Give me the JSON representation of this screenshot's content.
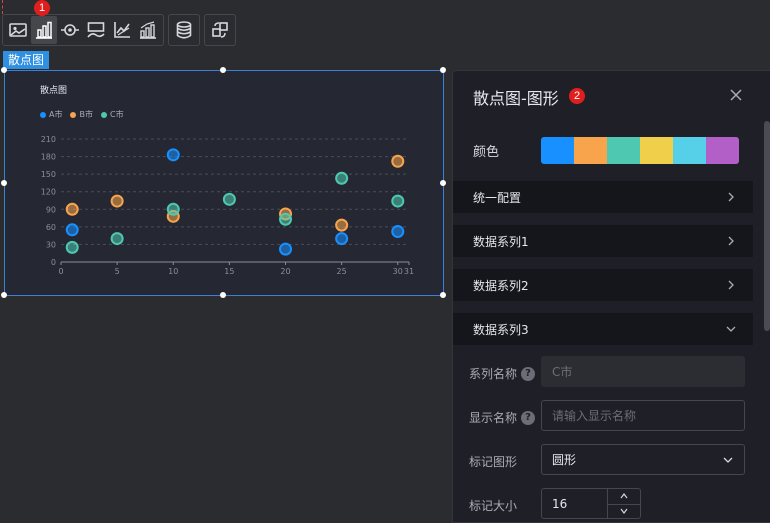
{
  "toolbar": {
    "groups": [
      [
        "image-icon",
        "bar-chart-icon",
        "radar-icon",
        "map-icon",
        "axis-chart-icon",
        "column-chart-icon"
      ],
      [
        "database-icon"
      ],
      [
        "swap-icon"
      ]
    ],
    "badge1": "1"
  },
  "widget": {
    "label": "散点图"
  },
  "panel": {
    "title": "散点图-图形",
    "badge2": "2",
    "color_label": "颜色",
    "colors": [
      "#1890ff",
      "#f7a44c",
      "#4ec8b0",
      "#f0d04a",
      "#55d0e8",
      "#b35fc8"
    ],
    "sections": [
      "统一配置",
      "数据系列1",
      "数据系列2",
      "数据系列3"
    ],
    "series_name_label": "系列名称",
    "series_name_value": "C市",
    "display_name_label": "显示名称",
    "display_name_placeholder": "请输入显示名称",
    "marker_shape_label": "标记图形",
    "marker_shape_value": "圆形",
    "marker_size_label": "标记大小",
    "marker_size_value": "16",
    "help_glyph": "?"
  },
  "chart_data": {
    "type": "scatter",
    "title": "散点图",
    "xlabel": "",
    "ylabel": "",
    "x_ticks": [
      "0",
      "5",
      "10",
      "15",
      "20",
      "25",
      "30",
      "31"
    ],
    "y_ticks": [
      "0",
      "30",
      "60",
      "90",
      "120",
      "150",
      "180",
      "210"
    ],
    "xlim": [
      0,
      31
    ],
    "ylim": [
      0,
      210
    ],
    "grid": true,
    "legend_position": "top-left",
    "series": [
      {
        "name": "A市",
        "color": "#1890ff",
        "points": [
          [
            1,
            55
          ],
          [
            10,
            183
          ],
          [
            20,
            22
          ],
          [
            25,
            40
          ],
          [
            30,
            52
          ]
        ]
      },
      {
        "name": "B市",
        "color": "#f7a44c",
        "points": [
          [
            1,
            90
          ],
          [
            5,
            104
          ],
          [
            10,
            78
          ],
          [
            20,
            82
          ],
          [
            25,
            63
          ],
          [
            30,
            172
          ]
        ]
      },
      {
        "name": "C市",
        "color": "#4ec8b0",
        "points": [
          [
            1,
            25
          ],
          [
            5,
            40
          ],
          [
            10,
            90
          ],
          [
            15,
            107
          ],
          [
            20,
            73
          ],
          [
            25,
            143
          ],
          [
            30,
            104
          ]
        ]
      }
    ]
  }
}
